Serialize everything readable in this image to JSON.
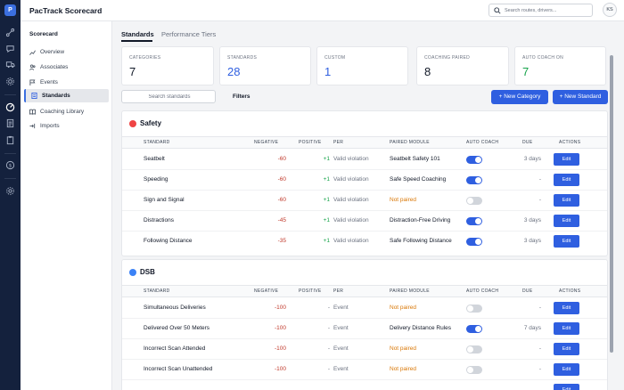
{
  "header": {
    "app_title": "PacTrack Scorecard",
    "search_placeholder": "Search routes, drivers...",
    "avatar_initials": "KS"
  },
  "rail": {
    "logo": "P",
    "icons": [
      "route-icon",
      "chat-icon",
      "truck-icon",
      "gear-icon",
      "gauge-icon",
      "document-icon",
      "clipboard-icon",
      "dollar-icon",
      "settings-icon"
    ]
  },
  "nav": {
    "title": "Scorecard",
    "items": [
      {
        "label": "Overview",
        "icon": "chart-icon"
      },
      {
        "label": "Associates",
        "icon": "users-icon"
      },
      {
        "label": "Events",
        "icon": "flag-icon"
      },
      {
        "label": "Standards",
        "icon": "document-icon",
        "active": true
      },
      {
        "label": "Coaching Library",
        "icon": "book-icon"
      },
      {
        "label": "Imports",
        "icon": "import-icon"
      }
    ]
  },
  "tabs": [
    "Standards",
    "Performance Tiers"
  ],
  "stats": [
    {
      "label": "CATEGORIES",
      "value": "7",
      "color": "#111827"
    },
    {
      "label": "STANDARDS",
      "value": "28",
      "color": "#2f5fe0"
    },
    {
      "label": "CUSTOM",
      "value": "1",
      "color": "#2f5fe0"
    },
    {
      "label": "COACHING PAIRED",
      "value": "8",
      "color": "#111827"
    },
    {
      "label": "AUTO COACH ON",
      "value": "7",
      "color": "#16a34a"
    }
  ],
  "toolbar": {
    "search_placeholder": "Search standards",
    "filters_label": "Filters",
    "new_category_label": "+ New Category",
    "new_standard_label": "+ New Standard"
  },
  "columns": [
    "STANDARD",
    "NEGATIVE",
    "POSITIVE",
    "PER",
    "PAIRED MODULE",
    "AUTO COACH",
    "DUE",
    "ACTIONS"
  ],
  "edit_label": "Edit",
  "sections": [
    {
      "title": "Safety",
      "dot_color": "#ef4444",
      "rows": [
        {
          "name": "Seatbelt",
          "negative": "-60",
          "positive": "+1",
          "per": "Valid violation",
          "module": "Seatbelt Safety 101",
          "paired": true,
          "auto_coach": true,
          "due": "3 days"
        },
        {
          "name": "Speeding",
          "negative": "-60",
          "positive": "+1",
          "per": "Valid violation",
          "module": "Safe Speed Coaching",
          "paired": true,
          "auto_coach": true,
          "due": "-"
        },
        {
          "name": "Sign and Signal",
          "negative": "-60",
          "positive": "+1",
          "per": "Valid violation",
          "module": "Not paired",
          "paired": false,
          "auto_coach": false,
          "due": "-"
        },
        {
          "name": "Distractions",
          "negative": "-45",
          "positive": "+1",
          "per": "Valid violation",
          "module": "Distraction-Free Driving",
          "paired": true,
          "auto_coach": true,
          "due": "3 days"
        },
        {
          "name": "Following Distance",
          "negative": "-35",
          "positive": "+1",
          "per": "Valid violation",
          "module": "Safe Following Distance",
          "paired": true,
          "auto_coach": true,
          "due": "3 days"
        }
      ]
    },
    {
      "title": "DSB",
      "dot_color": "#3b82f6",
      "rows": [
        {
          "name": "Simultaneous Deliveries",
          "negative": "-100",
          "positive": "-",
          "per": "Event",
          "module": "Not paired",
          "paired": false,
          "auto_coach": false,
          "due": "-"
        },
        {
          "name": "Delivered Over 50 Meters",
          "negative": "-100",
          "positive": "-",
          "per": "Event",
          "module": "Delivery Distance Rules",
          "paired": true,
          "auto_coach": true,
          "due": "7 days"
        },
        {
          "name": "Incorrect Scan Attended",
          "negative": "-100",
          "positive": "-",
          "per": "Event",
          "module": "Not paired",
          "paired": false,
          "auto_coach": false,
          "due": "-"
        },
        {
          "name": "Incorrect Scan Unattended",
          "negative": "-100",
          "positive": "-",
          "per": "Event",
          "module": "Not paired",
          "paired": false,
          "auto_coach": false,
          "due": "-"
        }
      ]
    }
  ]
}
